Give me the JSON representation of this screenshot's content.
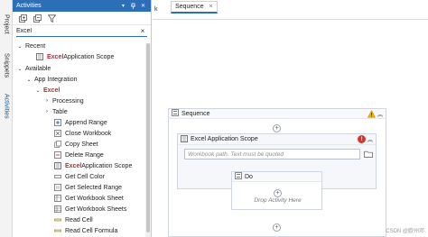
{
  "side_tabs": [
    "Project",
    "Snippets",
    "Activities"
  ],
  "panel": {
    "title": "Activities",
    "search_value": "Excel"
  },
  "tree": {
    "recent_label": "Recent",
    "recent_item": {
      "highlight": "Excel",
      "rest": " Application Scope"
    },
    "available_label": "Available",
    "app_integration_label": "App Integration",
    "excel_label": "Excel",
    "processing_label": "Processing",
    "table_label": "Table",
    "activities": [
      "Append Range",
      "Close Workbook",
      "Copy Sheet",
      "Delete Range",
      "Excel Application Scope",
      "Get Cell Color",
      "Get Selected Range",
      "Get Workbook Sheet",
      "Get Workbook Sheets",
      "Read Cell",
      "Read Cell Formula"
    ],
    "highlight_item": {
      "highlight": "Excel",
      "rest": " Application Scope"
    }
  },
  "designer": {
    "tab_fragment": "k",
    "doc_tab": "Sequence",
    "doc_tab_close": "×",
    "sequence_title": "Sequence",
    "excel_scope_title": "Excel Application Scope",
    "workbook_placeholder": "Workbook path. Text must be quoted",
    "do_title": "Do",
    "drop_text": "Drop Activity Here"
  },
  "watermark": "CSDN @欧州邓",
  "colors": {
    "accent": "#2d6fb7",
    "highlight": "#c0272d",
    "error": "#d9342b",
    "warning": "#f0b400"
  }
}
